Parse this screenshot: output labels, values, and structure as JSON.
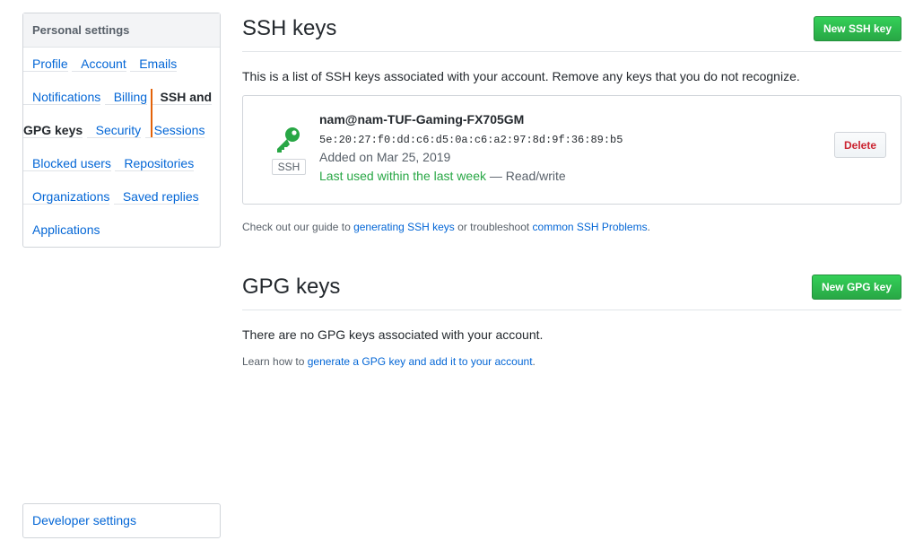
{
  "sidebar": {
    "heading": "Personal settings",
    "items": [
      {
        "label": "Profile"
      },
      {
        "label": "Account"
      },
      {
        "label": "Emails"
      },
      {
        "label": "Notifications"
      },
      {
        "label": "Billing"
      },
      {
        "label": "SSH and GPG keys",
        "selected": true
      },
      {
        "label": "Security"
      },
      {
        "label": "Sessions"
      },
      {
        "label": "Blocked users"
      },
      {
        "label": "Repositories"
      },
      {
        "label": "Organizations"
      },
      {
        "label": "Saved replies"
      },
      {
        "label": "Applications"
      }
    ],
    "developer_settings": "Developer settings"
  },
  "ssh": {
    "title": "SSH keys",
    "new_button": "New SSH key",
    "description": "This is a list of SSH keys associated with your account. Remove any keys that you do not recognize.",
    "key": {
      "type_label": "SSH",
      "icon": "key-icon",
      "title": "nam@nam-TUF-Gaming-FX705GM",
      "fingerprint": "5e:20:27:f0:dd:c6:d5:0a:c6:a2:97:8d:9f:36:89:b5",
      "added": "Added on Mar 25, 2019",
      "last_used": "Last used within the last week",
      "access": " — Read/write",
      "delete_button": "Delete"
    },
    "guide": {
      "prefix": "Check out our guide to ",
      "link1": "generating SSH keys",
      "middle": " or troubleshoot ",
      "link2": "common SSH Problems",
      "suffix": "."
    }
  },
  "gpg": {
    "title": "GPG keys",
    "new_button": "New GPG key",
    "empty_text": "There are no GPG keys associated with your account.",
    "learn": {
      "prefix": "Learn how to ",
      "link": "generate a GPG key and add it to your account",
      "suffix": "."
    }
  },
  "colors": {
    "accent_green": "#28a745",
    "link_blue": "#0366d6",
    "selected_bar": "#e36209",
    "danger_red": "#cb2431"
  }
}
